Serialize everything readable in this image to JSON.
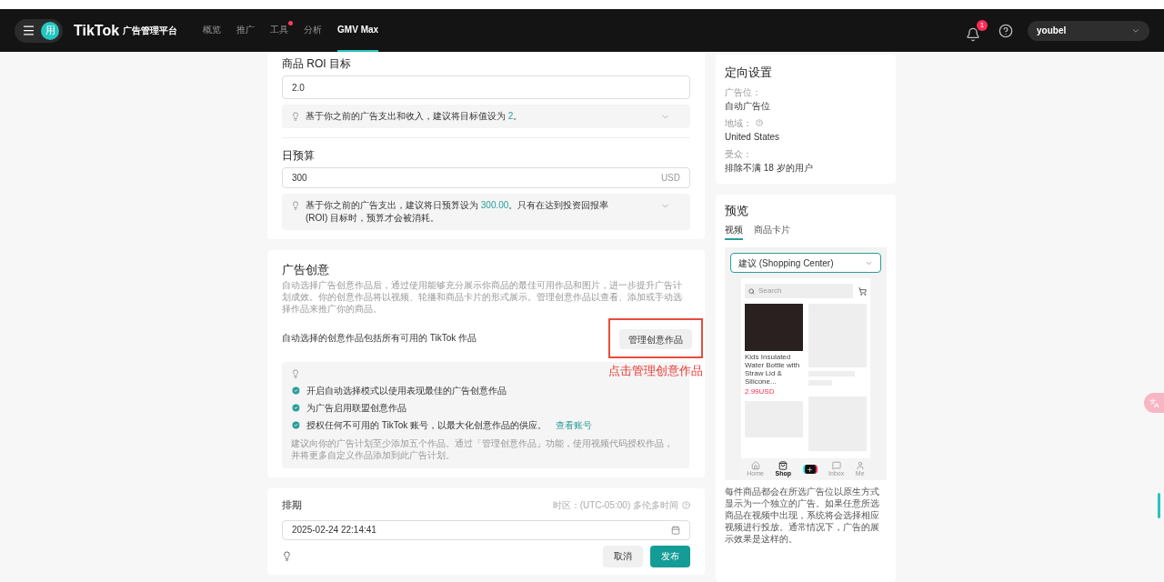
{
  "header": {
    "avatar": "用",
    "logo": "TikTok",
    "logo_sub": "广告管理平台",
    "nav": [
      {
        "label": "概览",
        "selected": false,
        "dot": false
      },
      {
        "label": "推广",
        "selected": false,
        "dot": false
      },
      {
        "label": "工具",
        "selected": false,
        "dot": true
      },
      {
        "label": "分析",
        "selected": false,
        "dot": false
      },
      {
        "label": "GMV Max",
        "selected": true,
        "dot": false
      }
    ],
    "notification_count": "1",
    "account": "youbel"
  },
  "roi": {
    "title": "商品 ROI 目标",
    "value": "2.0",
    "hint_before": "基于你之前的广告支出和收入，建议将目标值设为 ",
    "hint_value": "2",
    "hint_after": "。"
  },
  "budget": {
    "title": "日预算",
    "value": "300",
    "unit": "USD",
    "hint_before": "基于你之前的广告支出，建议将日预算设为 ",
    "hint_value": "300.00",
    "hint_after": "。只有在达到投资回报率 (ROI) 目标时，预算才会被消耗。"
  },
  "creative": {
    "title": "广告创意",
    "description": "自动选择广告创意作品后，通过使用能够充分展示你商品的最佳可用作品和图片，进一步提升广告计划成效。你的创意作品将以视频、轮播和商品卡片的形式展示。管理创意作品以查看、添加或手动选择作品来推广你的商品。",
    "auto_text": "自动选择的创意作品包括所有可用的 TikTok 作品",
    "manage_button": "管理创意作品",
    "annotation": "点击管理创意作品",
    "tips": [
      {
        "text": "开启自动选择模式以使用表现最佳的广告创意作品",
        "checked": true
      },
      {
        "text": "为广告启用联盟创意作品",
        "checked": true
      },
      {
        "text": "授权任何不可用的 TikTok 账号，以最大化创意作品的供应。",
        "link": "查看账号",
        "checked": true
      }
    ],
    "note": "建议向你的广告计划至少添加五个作品。通过「管理创意作品」功能，使用视频代码授权作品，并将更多自定义作品添加到此广告计划。"
  },
  "schedule": {
    "title": "排期",
    "timezone": "时区：(UTC-05:00) 多伦多时间",
    "value": "2025-02-24 22:14:41",
    "cancel": "取消",
    "publish": "发布"
  },
  "targeting": {
    "title": "定向设置",
    "fields": [
      {
        "label": "广告位：",
        "value": "自动广告位",
        "help": false
      },
      {
        "label": "地域：",
        "value": "United States",
        "help": true
      },
      {
        "label": "受众：",
        "value": "排除不满 18 岁的用户",
        "help": false
      }
    ]
  },
  "preview": {
    "title": "预览",
    "tabs": [
      {
        "label": "视频",
        "selected": true
      },
      {
        "label": "商品卡片",
        "selected": false
      }
    ],
    "dropdown": "建议 (Shopping Center)",
    "phone": {
      "search_placeholder": "Search",
      "product_title": "Kids Insulated Water Bottle with Straw Lid & Silicone...",
      "price": "2.99USD",
      "nav": [
        {
          "kind": "home",
          "label": "Home",
          "selected": false
        },
        {
          "kind": "shop",
          "label": "Shop",
          "selected": true
        },
        {
          "kind": "create",
          "selected": false
        },
        {
          "kind": "inbox",
          "label": "Inbox",
          "selected": false
        },
        {
          "kind": "me",
          "label": "Me",
          "selected": false
        }
      ]
    },
    "caption": "每件商品都会在所选广告位以原生方式显示为一个独立的广告。如果任意所选商品在视频中出现，系统将会选择相应视频进行投放。通常情况下，广告的展示效果是这样的。"
  }
}
